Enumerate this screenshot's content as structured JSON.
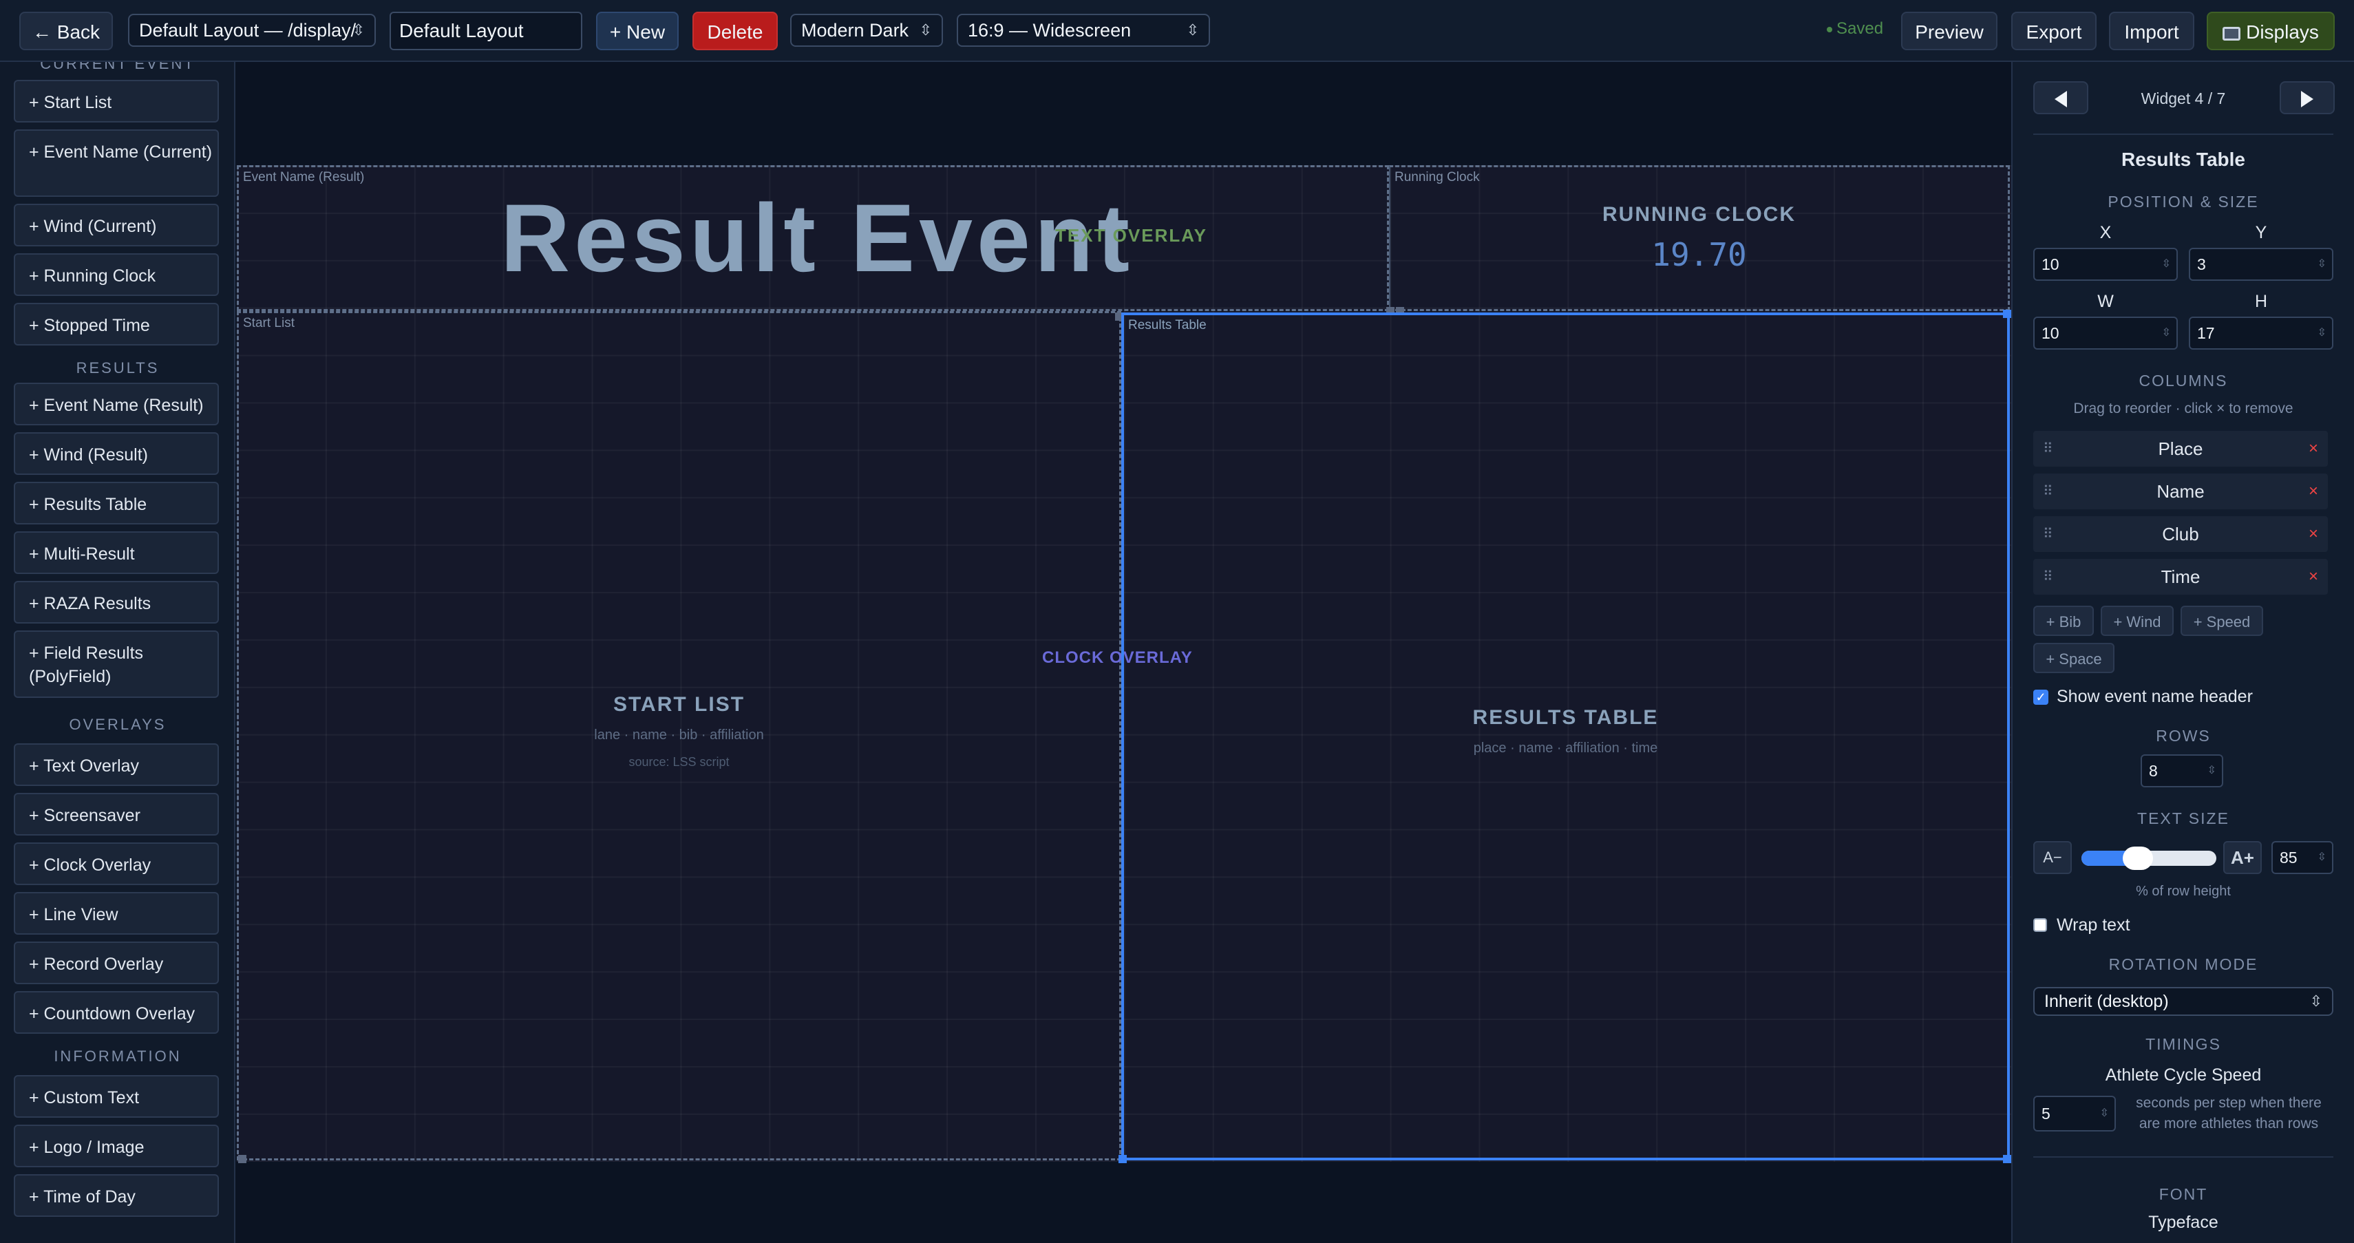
{
  "toolbar": {
    "back": "← Back",
    "layout_select": "Default Layout — /display/",
    "layout_name": "Default Layout",
    "new": "+ New",
    "delete": "Delete",
    "theme": "Modern Dark",
    "aspect": "16:9 — Widescreen",
    "saved": "Saved",
    "preview": "Preview",
    "export": "Export",
    "import": "Import",
    "displays": "Displays"
  },
  "sidebar": {
    "partial_header": "CURRENT EVENT",
    "current_items": [
      "+ Start List",
      "+ Event Name (Current)",
      "+ Wind (Current)",
      "+ Running Clock",
      "+ Stopped Time"
    ],
    "results_header": "RESULTS",
    "results_items": [
      "+ Event Name (Result)",
      "+ Wind (Result)",
      "+ Results Table",
      "+ Multi-Result",
      "+ RAZA Results",
      "+ Field Results (PolyField)"
    ],
    "overlays_header": "OVERLAYS",
    "overlay_items": [
      "+ Text Overlay",
      "+ Screensaver",
      "+ Clock Overlay",
      "+ Line View",
      "+ Record Overlay",
      "+ Countdown Overlay"
    ],
    "information_header": "INFORMATION",
    "information_items": [
      "+ Custom Text",
      "+ Logo / Image",
      "+ Time of Day"
    ]
  },
  "canvas": {
    "header_widget_label": "Event Name (Result)",
    "event_title": "Result Event",
    "text_overlay": "TEXT OVERLAY",
    "running_clock_label": "Running Clock",
    "running_clock_title": "RUNNING CLOCK",
    "running_clock_value": "19.70",
    "start_list_label": "Start List",
    "start_list_title": "START LIST",
    "start_list_fields": "lane · name · bib · affiliation",
    "start_list_source": "source: LSS script",
    "clock_overlay": "CLOCK OVERLAY",
    "results_table_label": "Results Table",
    "results_table_title": "RESULTS TABLE",
    "results_table_fields": "place · name · affiliation · time"
  },
  "panel": {
    "widget_counter": "Widget 4 / 7",
    "widget_title": "Results Table",
    "position_size": "POSITION & SIZE",
    "x_label": "X",
    "y_label": "Y",
    "w_label": "W",
    "h_label": "H",
    "x": "10",
    "y": "3",
    "w": "10",
    "h": "17",
    "columns_header": "COLUMNS",
    "columns_hint": "Drag to reorder · click × to remove",
    "columns": [
      "Place",
      "Name",
      "Club",
      "Time"
    ],
    "add_columns": [
      "+ Bib",
      "+ Wind",
      "+ Speed",
      "+ Space"
    ],
    "show_header_label": "Show event name header",
    "show_header_checked": true,
    "rows_header": "ROWS",
    "rows": "8",
    "text_size_header": "TEXT SIZE",
    "text_size_minus": "A−",
    "text_size_plus": "A+",
    "text_size_value": "85",
    "text_size_fraction": 0.42,
    "text_size_hint": "% of row height",
    "wrap_text_label": "Wrap text",
    "wrap_text_checked": false,
    "rotation_header": "ROTATION MODE",
    "rotation_value": "Inherit (desktop)",
    "timings_header": "TIMINGS",
    "cycle_speed_label": "Athlete Cycle Speed",
    "cycle_speed_value": "5",
    "cycle_speed_hint": "seconds per step when there are more athletes than rows",
    "font_header": "FONT",
    "typeface_label": "Typeface"
  },
  "colors": {
    "accent_blue": "#3b82f6",
    "delete_red": "#b91c1c",
    "displays_green": "#2f4a1c",
    "saved_green": "#4f8f4f"
  }
}
